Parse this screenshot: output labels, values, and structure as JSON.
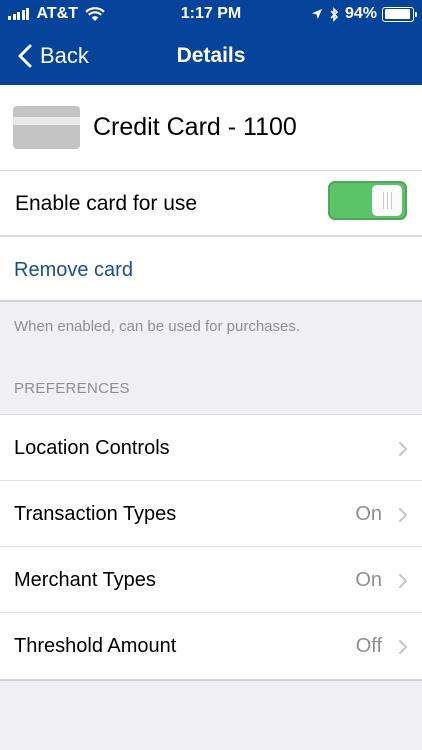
{
  "status_bar": {
    "carrier": "AT&T",
    "time": "1:17 PM",
    "battery": "94%",
    "battery_level": 0.94
  },
  "nav": {
    "back_label": "Back",
    "title": "Details"
  },
  "card": {
    "title": "Credit Card - 1100",
    "icon": "credit-card-icon"
  },
  "enable_row": {
    "label": "Enable card for use",
    "enabled": true,
    "toggle_color": "#5bc466"
  },
  "remove_card": {
    "label": "Remove card",
    "color": "#1a4f8b"
  },
  "info_text": "When enabled, can be used for purchases.",
  "preferences": {
    "header": "PREFERENCES",
    "items": [
      {
        "label": "Location Controls",
        "value": ""
      },
      {
        "label": "Transaction Types",
        "value": "On"
      },
      {
        "label": "Merchant Types",
        "value": "On"
      },
      {
        "label": "Threshold Amount",
        "value": "Off"
      }
    ]
  },
  "colors": {
    "header_bg": "#05449a",
    "page_bg": "#efeff4"
  }
}
